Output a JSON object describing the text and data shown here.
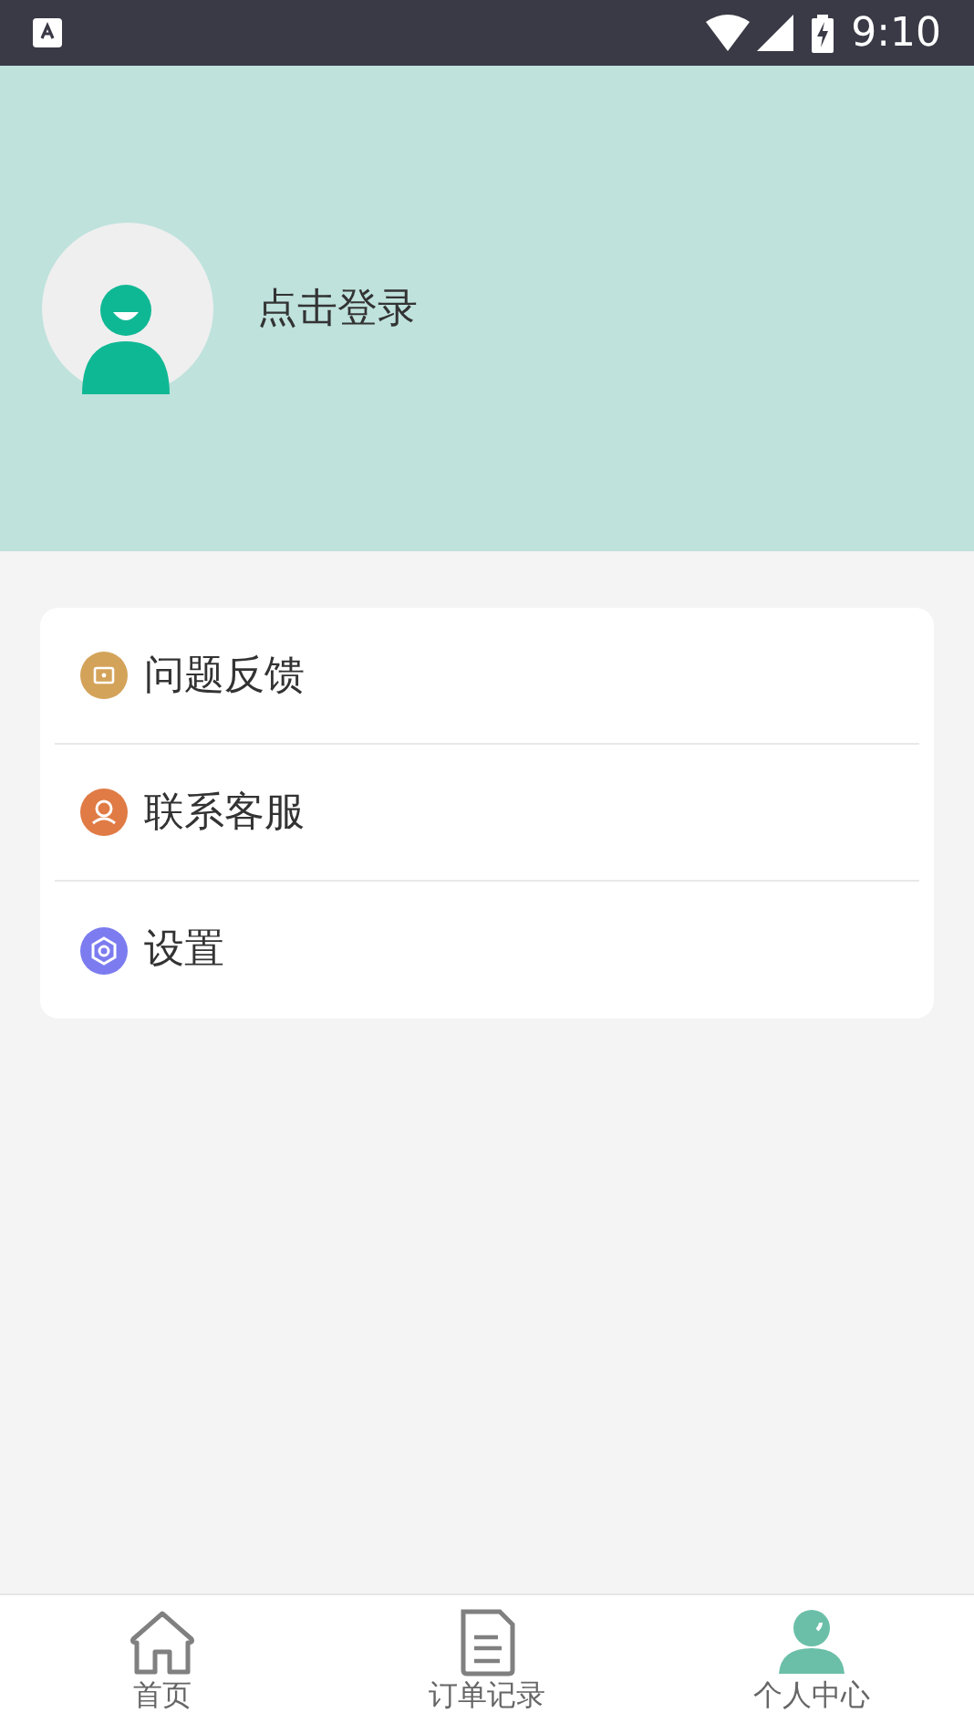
{
  "status_bar": {
    "time": "9:10"
  },
  "profile": {
    "login_text": "点击登录"
  },
  "menu": [
    {
      "kind": "feedback",
      "label": "问题反馈",
      "color": "#d4a35a"
    },
    {
      "kind": "service",
      "label": "联系客服",
      "color": "#e07b45"
    },
    {
      "kind": "settings",
      "label": "设置",
      "color": "#7c7cf0"
    }
  ],
  "tabs": [
    {
      "kind": "home",
      "label": "首页",
      "selected": false
    },
    {
      "kind": "orders",
      "label": "订单记录",
      "selected": false
    },
    {
      "kind": "profile",
      "label": "个人中心",
      "selected": true
    }
  ]
}
